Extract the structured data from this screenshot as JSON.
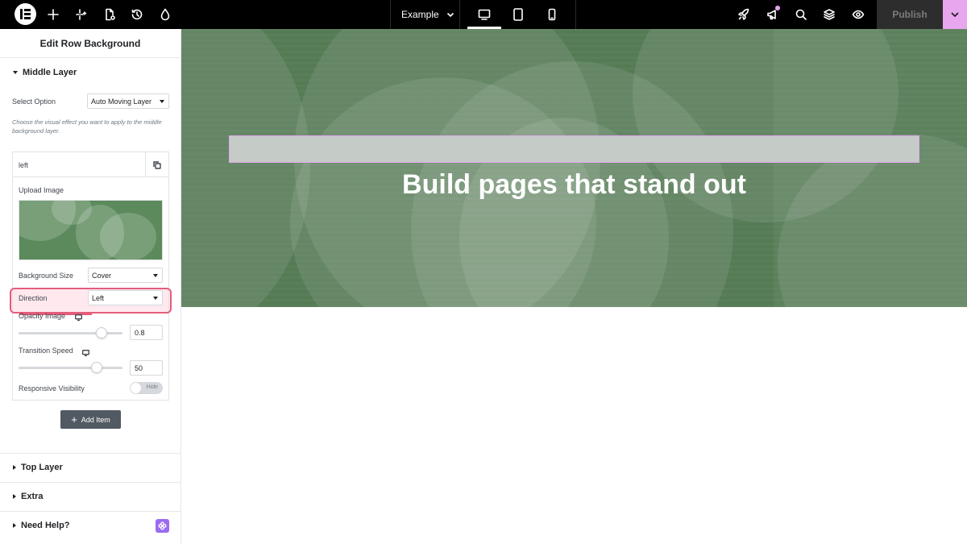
{
  "topbar": {
    "document_name": "Example",
    "publish_label": "Publish"
  },
  "panel": {
    "title": "Edit Row Background",
    "middle_layer": {
      "heading": "Middle Layer",
      "select_option_label": "Select Option",
      "select_option_value": "Auto Moving Layer",
      "help_text": "Choose the visual effect you want to apply to the middle background layer.",
      "item": {
        "title": "left",
        "upload_image_label": "Upload Image",
        "background_size_label": "Background Size",
        "background_size_value": "Cover",
        "direction_label": "Direction",
        "direction_value": "Left",
        "opacity_label": "Opacity Image",
        "opacity_value": "0.8",
        "transition_label": "Transition Speed",
        "transition_value": "50",
        "responsive_label": "Responsive Visibility",
        "responsive_toggle_text": "Hide"
      },
      "add_item_label": "Add Item"
    },
    "top_layer_heading": "Top Layer",
    "extra_heading": "Extra",
    "need_help_heading": "Need Help?"
  },
  "canvas": {
    "heading": "Build pages that stand out"
  },
  "colors": {
    "canvas_green": "#557b55",
    "accent_pink": "#e8a6ef",
    "highlight_red": "#e35d7b",
    "add_button": "#515962"
  }
}
